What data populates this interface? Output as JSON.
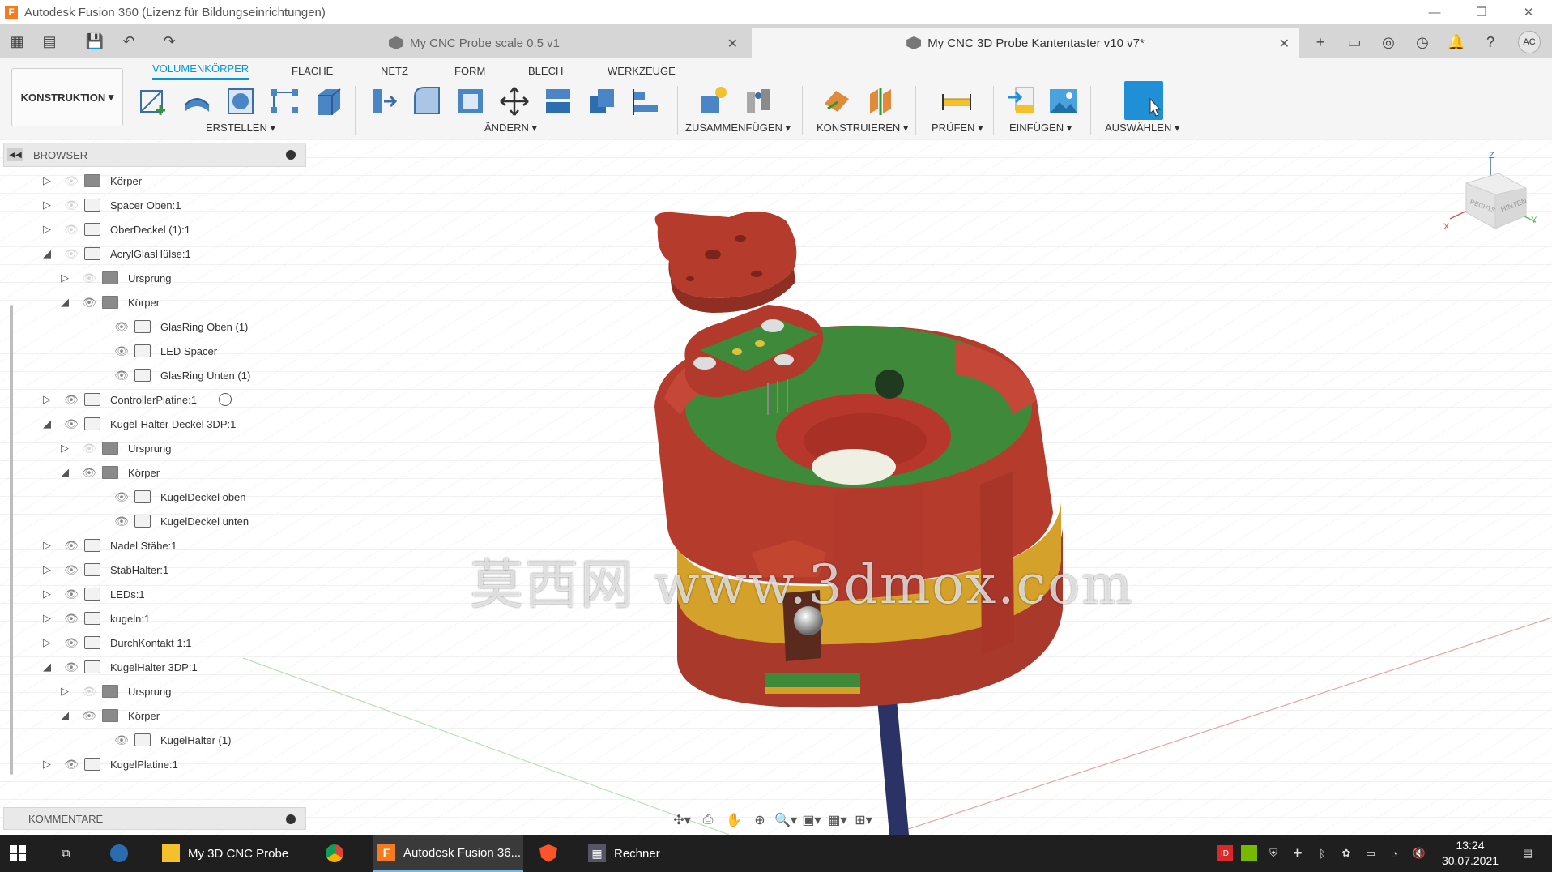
{
  "window": {
    "title": "Autodesk Fusion 360 (Lizenz für Bildungseinrichtungen)",
    "app_logo": "F"
  },
  "doc_tabs": [
    {
      "label": "My CNC Probe scale 0.5 v1",
      "active": false
    },
    {
      "label": "My CNC 3D Probe Kantentaster v10 v7*",
      "active": true
    }
  ],
  "user_avatar": "AC",
  "toolbar": {
    "workspace": "KONSTRUKTION",
    "tabs": [
      "VOLUMENKÖRPER",
      "FLÄCHE",
      "NETZ",
      "FORM",
      "BLECH",
      "WERKZEUGE"
    ],
    "active_tab": "VOLUMENKÖRPER",
    "groups": [
      "ERSTELLEN",
      "ÄNDERN",
      "ZUSAMMENFÜGEN",
      "KONSTRUIEREN",
      "PRÜFEN",
      "EINFÜGEN",
      "AUSWÄHLEN"
    ]
  },
  "browser": {
    "title": "BROWSER",
    "items": [
      {
        "label": "Körper",
        "depth": 0,
        "expanded": false,
        "visible": false,
        "kind": "folder"
      },
      {
        "label": "Spacer Oben:1",
        "depth": 0,
        "expanded": false,
        "visible": false,
        "kind": "component"
      },
      {
        "label": "OberDeckel (1):1",
        "depth": 0,
        "expanded": false,
        "visible": false,
        "kind": "component"
      },
      {
        "label": "AcrylGlasHülse:1",
        "depth": 0,
        "expanded": true,
        "visible": false,
        "kind": "component"
      },
      {
        "label": "Ursprung",
        "depth": 1,
        "expanded": false,
        "visible": false,
        "kind": "folder"
      },
      {
        "label": "Körper",
        "depth": 1,
        "expanded": true,
        "visible": true,
        "kind": "folder"
      },
      {
        "label": "GlasRing Oben (1)",
        "depth": 2,
        "visible": true,
        "kind": "body"
      },
      {
        "label": "LED Spacer",
        "depth": 2,
        "visible": true,
        "kind": "body"
      },
      {
        "label": "GlasRing Unten (1)",
        "depth": 2,
        "visible": true,
        "kind": "body"
      },
      {
        "label": "ControllerPlatine:1",
        "depth": 0,
        "expanded": false,
        "visible": true,
        "kind": "component",
        "radio": true
      },
      {
        "label": "Kugel-Halter Deckel 3DP:1",
        "depth": 0,
        "expanded": true,
        "visible": true,
        "kind": "component"
      },
      {
        "label": "Ursprung",
        "depth": 1,
        "expanded": false,
        "visible": false,
        "kind": "folder"
      },
      {
        "label": "Körper",
        "depth": 1,
        "expanded": true,
        "visible": true,
        "kind": "folder"
      },
      {
        "label": "KugelDeckel oben",
        "depth": 2,
        "visible": true,
        "kind": "body"
      },
      {
        "label": "KugelDeckel unten",
        "depth": 2,
        "visible": true,
        "kind": "body"
      },
      {
        "label": "Nadel Stäbe:1",
        "depth": 0,
        "expanded": false,
        "visible": true,
        "kind": "component"
      },
      {
        "label": "StabHalter:1",
        "depth": 0,
        "expanded": false,
        "visible": true,
        "kind": "component"
      },
      {
        "label": "LEDs:1",
        "depth": 0,
        "expanded": false,
        "visible": true,
        "kind": "component"
      },
      {
        "label": "kugeln:1",
        "depth": 0,
        "expanded": false,
        "visible": true,
        "kind": "component"
      },
      {
        "label": "DurchKontakt 1:1",
        "depth": 0,
        "expanded": false,
        "visible": true,
        "kind": "component"
      },
      {
        "label": "KugelHalter 3DP:1",
        "depth": 0,
        "expanded": true,
        "visible": true,
        "kind": "component"
      },
      {
        "label": "Ursprung",
        "depth": 1,
        "expanded": false,
        "visible": false,
        "kind": "folder"
      },
      {
        "label": "Körper",
        "depth": 1,
        "expanded": true,
        "visible": true,
        "kind": "folder"
      },
      {
        "label": "KugelHalter (1)",
        "depth": 2,
        "visible": true,
        "kind": "body"
      },
      {
        "label": "KugelPlatine:1",
        "depth": 0,
        "expanded": false,
        "visible": true,
        "kind": "component"
      }
    ]
  },
  "comments": {
    "title": "KOMMENTARE"
  },
  "viewcube": {
    "axis_z": "Z",
    "axis_x": "X",
    "axis_y": "Y",
    "face_right": "RECHTS",
    "face_back": "HINTEN"
  },
  "watermark": "莫西网 www.3dmox.com",
  "taskbar": {
    "items": [
      {
        "label": "My 3D CNC Probe",
        "icon": "folder-icon",
        "active": false
      },
      {
        "label": "",
        "icon": "chrome-icon",
        "active": false
      },
      {
        "label": "Autodesk Fusion 36...",
        "icon": "fusion-icon",
        "active": true
      },
      {
        "label": "",
        "icon": "brave-icon",
        "active": false
      },
      {
        "label": "Rechner",
        "icon": "calculator-icon",
        "active": false
      }
    ],
    "time": "13:24",
    "date": "30.07.2021"
  },
  "colors": {
    "accent": "#0696d7",
    "body_red": "#b23a2c",
    "body_green": "#3f8a3a",
    "body_yellow": "#d8a928"
  }
}
